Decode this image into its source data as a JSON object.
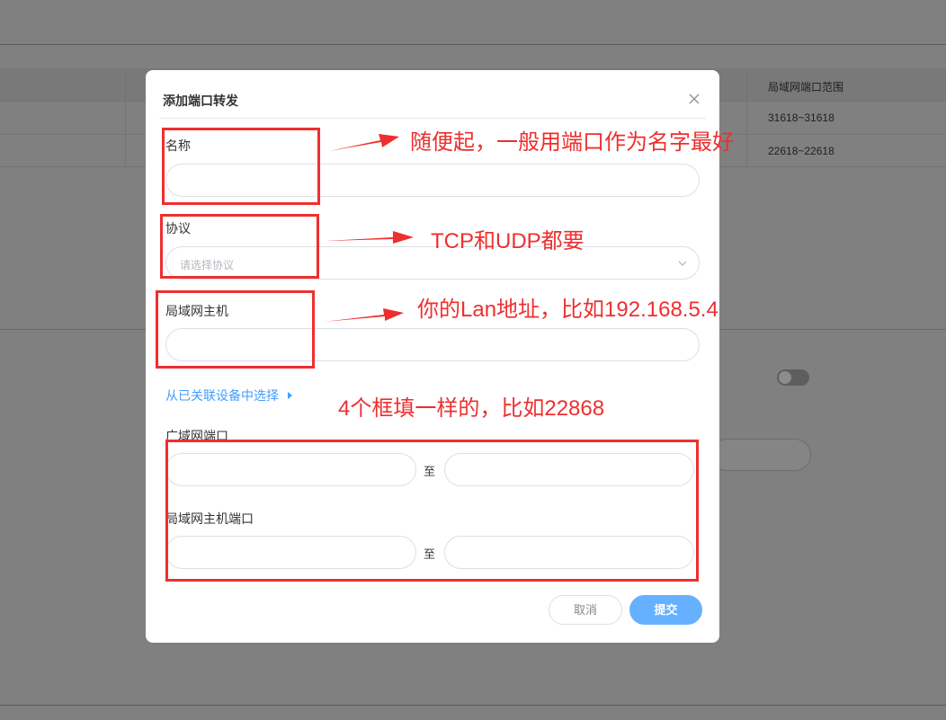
{
  "background": {
    "table_header": "局域网端口范围",
    "rows": [
      "31618~31618",
      "22618~22618"
    ]
  },
  "dialog": {
    "title": "添加端口转发",
    "fields": {
      "name_label": "名称",
      "protocol_label": "协议",
      "protocol_placeholder": "请选择协议",
      "lan_host_label": "局域网主机",
      "select_device_link": "从已关联设备中选择",
      "wan_port_label": "广域网端口",
      "range_separator": "至",
      "lan_host_port_label": "局域网主机端口"
    },
    "buttons": {
      "cancel": "取消",
      "submit": "提交"
    }
  },
  "annotations": {
    "name_note": "随便起，一般用端口作为名字最好",
    "protocol_note": "TCP和UDP都要",
    "lan_host_note": "你的Lan地址，比如192.168.5.4",
    "ports_note": "4个框填一样的，比如22868",
    "color": "#ee2f2f"
  },
  "colors": {
    "accent": "#409eff",
    "submit_bg": "#66b1ff",
    "overlay": "#808080"
  }
}
